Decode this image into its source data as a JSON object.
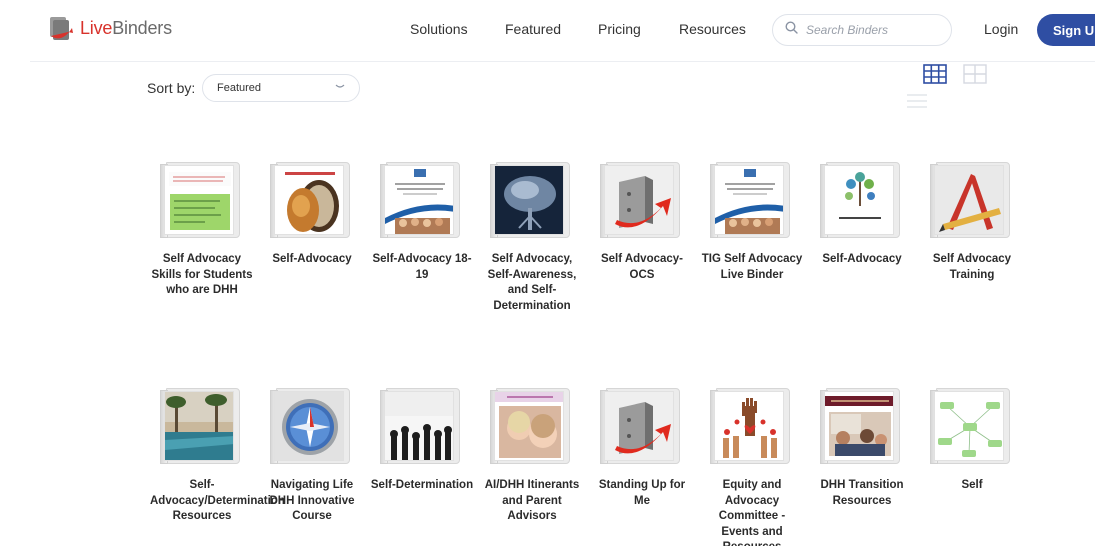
{
  "header": {
    "logo": {
      "live": "Live",
      "binders": "Binders"
    },
    "nav": [
      {
        "label": "Solutions"
      },
      {
        "label": "Featured"
      },
      {
        "label": "Pricing"
      },
      {
        "label": "Resources"
      }
    ],
    "search": {
      "placeholder": "Search Binders"
    },
    "login_label": "Login",
    "signup_label": "Sign Up"
  },
  "toolbar": {
    "sort_label": "Sort by:",
    "sort_value": "Featured"
  },
  "colors": {
    "brand_red": "#d8322b",
    "brand_blue": "#2f4ea3",
    "active_view_icon": "#2f4ea3",
    "inactive_view_icon": "#c9cdd6"
  },
  "binders": [
    {
      "title": "Self Advocacy Skills for Students who are DHH",
      "cover": "green-note"
    },
    {
      "title": "Self-Advocacy",
      "cover": "lion-mirror"
    },
    {
      "title": "Self-Advocacy 18-19",
      "cover": "best-practices"
    },
    {
      "title": "Self Advocacy, Self-Awareness, and Self-Determination",
      "cover": "word-tree"
    },
    {
      "title": "Self Advocacy-OCS",
      "cover": "default-binder"
    },
    {
      "title": "TIG Self Advocacy Live Binder",
      "cover": "best-practices"
    },
    {
      "title": "Self-Advocacy",
      "cover": "credential"
    },
    {
      "title": "Self Advocacy Training",
      "cover": "pencil-ruler"
    },
    {
      "title": "Self-Advocacy/Determination Resources",
      "cover": "pool-palms"
    },
    {
      "title": "Navigating Life DHH Innovative Course",
      "cover": "compass"
    },
    {
      "title": "Self-Determination",
      "cover": "raised-hands"
    },
    {
      "title": "AI/DHH Itinerants and Parent Advisors",
      "cover": "kids-whisper"
    },
    {
      "title": "Standing Up for Me",
      "cover": "default-binder"
    },
    {
      "title": "Equity and Advocacy Committee - Events and Resources",
      "cover": "hearts-hands"
    },
    {
      "title": "DHH Transition Resources",
      "cover": "transition-resource"
    },
    {
      "title": "Self",
      "cover": "mind-map"
    }
  ]
}
